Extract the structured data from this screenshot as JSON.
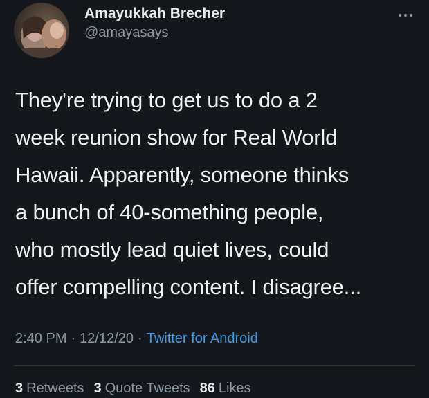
{
  "tweet": {
    "display_name": "Amayukkah Brecher",
    "handle": "@amayasays",
    "text": "They're trying to get us to do a 2\nweek reunion show for Real World\nHawaii. Apparently, someone thinks\na bunch of 40-something people,\nwho mostly lead quiet lives, could\noffer compelling content. I disagree...",
    "time": "2:40 PM",
    "separator": "·",
    "date": "12/12/20",
    "source": "Twitter for Android",
    "more_icon": "more-horizontal-icon"
  },
  "stats": [
    {
      "count": "3",
      "label": "Retweets"
    },
    {
      "count": "3",
      "label": "Quote Tweets"
    },
    {
      "count": "86",
      "label": "Likes"
    }
  ],
  "colors": {
    "background": "#14171b",
    "text": "#e7e9ea",
    "secondary": "#8b98a5",
    "link": "#3b9ee6"
  }
}
